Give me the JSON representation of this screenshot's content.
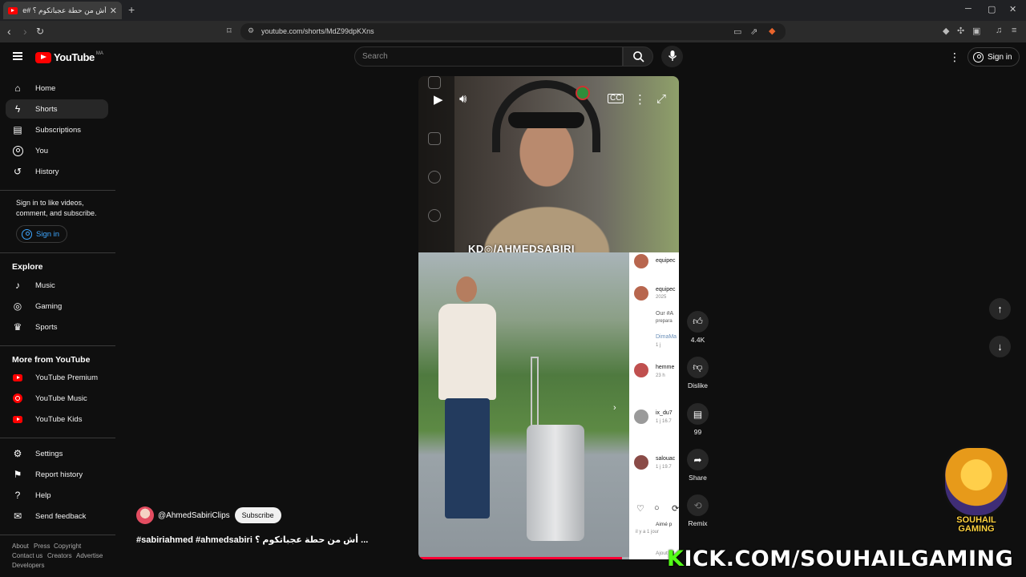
{
  "browser": {
    "tab_title": "أش من حطة عجباتكوم ؟ #ouTube",
    "url": "youtube.com/shorts/MdZ99dpKXns",
    "new_tab": "+",
    "close_tab": "✕"
  },
  "header": {
    "logo_text": "YouTube",
    "region": "MA",
    "search_placeholder": "Search",
    "sign_in": "Sign in"
  },
  "sidebar": {
    "main": [
      {
        "label": "Home",
        "icon": "home-icon"
      },
      {
        "label": "Shorts",
        "icon": "shorts-icon",
        "active": true
      },
      {
        "label": "Subscriptions",
        "icon": "subscriptions-icon"
      },
      {
        "label": "You",
        "icon": "you-icon"
      },
      {
        "label": "History",
        "icon": "history-icon"
      }
    ],
    "signin_promo": "Sign in to like videos, comment, and subscribe.",
    "signin_button": "Sign in",
    "explore_heading": "Explore",
    "explore": [
      {
        "label": "Music",
        "icon": "music-icon"
      },
      {
        "label": "Gaming",
        "icon": "gaming-icon"
      },
      {
        "label": "Sports",
        "icon": "sports-icon"
      }
    ],
    "more_heading": "More from YouTube",
    "more": [
      {
        "label": "YouTube Premium",
        "icon": "youtube-premium-icon"
      },
      {
        "label": "YouTube Music",
        "icon": "youtube-music-icon"
      },
      {
        "label": "YouTube Kids",
        "icon": "youtube-kids-icon"
      }
    ],
    "settings": [
      {
        "label": "Settings",
        "icon": "gear-icon"
      },
      {
        "label": "Report history",
        "icon": "flag-icon"
      },
      {
        "label": "Help",
        "icon": "help-icon"
      },
      {
        "label": "Send feedback",
        "icon": "feedback-icon"
      }
    ],
    "footer": [
      "About",
      "Press",
      "Copyright",
      "Contact us",
      "Creators",
      "Advertise",
      "Developers"
    ]
  },
  "short": {
    "channel": "@AhmedSabiriClips",
    "subscribe": "Subscribe",
    "title": "#sabiriahmed #ahmedsabiri أش من حطة عجباتكوم ؟ ...",
    "watermark": "KD◎/AHMEDSABIRI",
    "progress": 0.78,
    "comments": [
      {
        "name": "equipec",
        "sub": ""
      },
      {
        "name": "equipec",
        "sub": "2025"
      },
      {
        "name": "Our #A",
        "sub": "prepara"
      },
      {
        "name": "DimaMa",
        "sub": "1 j"
      },
      {
        "name": "hemme",
        "sub": "23 h"
      },
      {
        "name": "ix_du7",
        "sub": "1 j 16.7"
      },
      {
        "name": "salouac",
        "sub": "1 j 19.7"
      },
      {
        "name": "Aimé p",
        "sub": "il y a 1 jour"
      },
      {
        "name": "Ajout",
        "sub": ""
      }
    ]
  },
  "actions": {
    "like_count": "4.4K",
    "dislike": "Dislike",
    "comments_count": "99",
    "share": "Share",
    "remix": "Remix"
  },
  "overlay": {
    "kick_k": "K",
    "kick_rest": "ICK.COM/SOUHAILGAMING",
    "brand_line1": "SOUHAIL",
    "brand_line2": "GAMING"
  },
  "colors": {
    "accent": "#ff0000",
    "kick_green": "#53fc18",
    "link_blue": "#3ea6ff"
  }
}
